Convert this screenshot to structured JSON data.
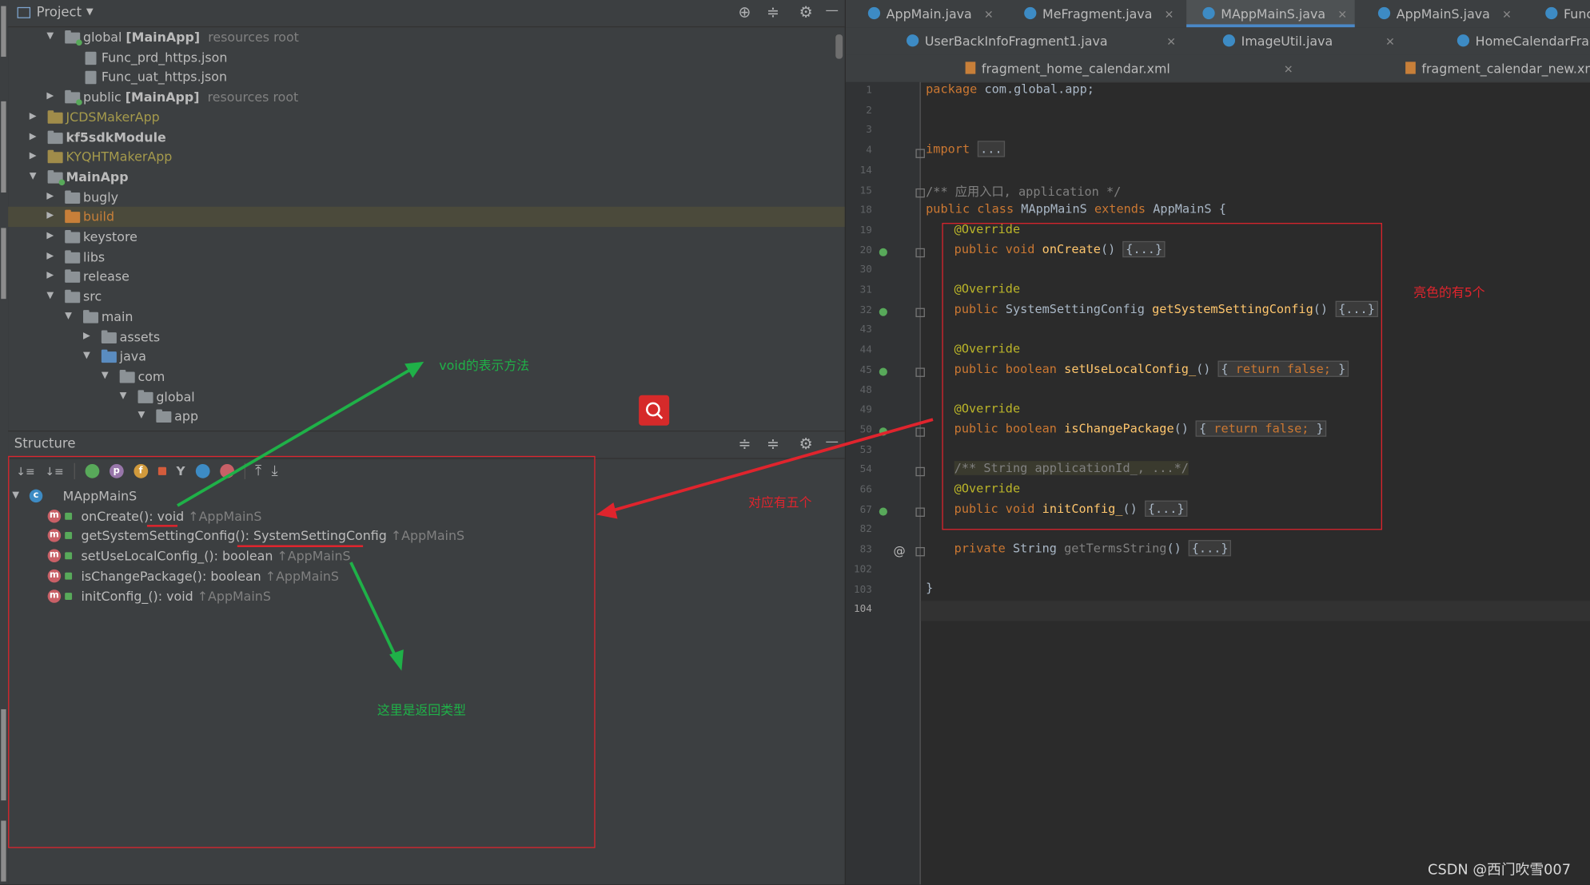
{
  "project_header": {
    "title": "Project",
    "title_caret": "▼",
    "crosshair_icon": "⊕",
    "collapse_icon": "≑",
    "gear_icon": "⚙",
    "minimize_icon": "—"
  },
  "project_tree": [
    {
      "name": "global",
      "suffix": "[MainApp]",
      "hint": "resources root",
      "arrow": "▼"
    },
    {
      "name": "Func_prd_https.json"
    },
    {
      "name": "Func_uat_https.json"
    },
    {
      "name": "public",
      "suffix": "[MainApp]",
      "hint": "resources root",
      "arrow": "▶"
    },
    {
      "name": "JCDSMakerApp",
      "arrow": "▶"
    },
    {
      "name": "kf5sdkModule",
      "arrow": "▶"
    },
    {
      "name": "KYQHTMakerApp",
      "arrow": "▶"
    },
    {
      "name": "MainApp",
      "arrow": "▼"
    },
    {
      "name": "bugly",
      "arrow": "▶"
    },
    {
      "name": "build",
      "arrow": "▶"
    },
    {
      "name": "keystore",
      "arrow": "▶"
    },
    {
      "name": "libs",
      "arrow": "▶"
    },
    {
      "name": "release",
      "arrow": "▶"
    },
    {
      "name": "src",
      "arrow": "▼"
    },
    {
      "name": "main",
      "arrow": "▼"
    },
    {
      "name": "assets",
      "arrow": "▶"
    },
    {
      "name": "java",
      "arrow": "▼"
    },
    {
      "name": "com",
      "arrow": "▼"
    },
    {
      "name": "global",
      "arrow": "▼"
    },
    {
      "name": "app",
      "arrow": "▼"
    }
  ],
  "structure_header": {
    "title": "Structure",
    "expand_icon": "≑",
    "collapse_icon": "≑",
    "gear_icon": "⚙",
    "minimize_icon": "—"
  },
  "structure_toolbar": {
    "sort_alpha_icon": "↓≡",
    "sort_type_icon": "↓≡",
    "p_badge": "p",
    "f_badge": "f",
    "branch_icon": "Y",
    "up_arrow": "⤒",
    "down_arrow": "⤓"
  },
  "structure_tree": {
    "root": {
      "arrow": "▼",
      "badge": "c",
      "name": "MAppMainS"
    },
    "methods": [
      {
        "badge": "m",
        "signature": "onCreate(): void",
        "inherited": "↑AppMainS"
      },
      {
        "badge": "m",
        "signature": "getSystemSettingConfig(): SystemSettingConfig",
        "inherited": "↑AppMainS"
      },
      {
        "badge": "m",
        "signature": "setUseLocalConfig_(): boolean",
        "inherited": "↑AppMainS"
      },
      {
        "badge": "m",
        "signature": "isChangePackage(): boolean",
        "inherited": "↑AppMainS"
      },
      {
        "badge": "m",
        "signature": "initConfig_(): void",
        "inherited": "↑AppMainS"
      }
    ]
  },
  "editor_tabs": {
    "row1": [
      {
        "label": "AppMain.java",
        "close": "✕"
      },
      {
        "label": "MeFragment.java",
        "close": "✕"
      },
      {
        "label": "MAppMainS.java",
        "close": "✕",
        "active": true
      },
      {
        "label": "AppMainS.java",
        "close": "✕"
      },
      {
        "label": "Func"
      }
    ],
    "row2": [
      {
        "label": "UserBackInfoFragment1.java",
        "close": "✕"
      },
      {
        "label": "ImageUtil.java",
        "close": "✕"
      },
      {
        "label": "HomeCalendarFrag"
      }
    ],
    "row3": [
      {
        "label": "fragment_home_calendar.xml",
        "close": "✕"
      },
      {
        "label": "fragment_calendar_new.xml"
      }
    ]
  },
  "line_numbers": [
    "1",
    "2",
    "3",
    "4",
    "14",
    "15",
    "18",
    "19",
    "20",
    "30",
    "31",
    "32",
    "43",
    "44",
    "45",
    "48",
    "49",
    "50",
    "53",
    "54",
    "66",
    "67",
    "82",
    "83",
    "102",
    "103",
    "104"
  ],
  "code": {
    "l1_kw": "package",
    "l1_rest": " com.global.app;",
    "l4_kw": "import",
    "l4_fold": "...",
    "l15": "/** 应用入口, application */",
    "l18_kw": "public class",
    "l18_name": " MAppMainS ",
    "l18_ext": "extends",
    "l18_rest": " AppMainS {",
    "override": "@Override",
    "m1_kw": "public void",
    "m1_fn": "onCreate",
    "m1_rest": "() ",
    "m1_fold": "{...}",
    "m2_kw": "public",
    "m2_type": " SystemSettingConfig ",
    "m2_fn": "getSystemSettingConfig",
    "m2_rest": "() ",
    "m2_fold": "{...}",
    "m3_kw": "public boolean",
    "m3_fn": "setUseLocalConfig_",
    "m3_rest": "() ",
    "m3_fold_open": "{ ",
    "m3_ret": "return false;",
    "m3_fold_close": " }",
    "m4_kw": "public boolean",
    "m4_fn": "isChangePackage",
    "m4_rest": "() ",
    "m4_fold_open": "{ ",
    "m4_ret": "return false;",
    "m4_fold_close": " }",
    "doc54": "/** String applicationId_, ...*/",
    "m5_kw": "public void",
    "m5_fn": "initConfig_",
    "m5_rest": "() ",
    "m5_fold": "{...}",
    "p_kw": "private",
    "p_type": " String ",
    "p_fn": "getTermsString",
    "p_rest": "() ",
    "p_fold": "{...}",
    "closing": "}",
    "at_marker": "@"
  },
  "annotations": {
    "void_note": "void的表示方法",
    "five_note": "对应有五个",
    "bright_note": "亮色的有5个",
    "return_note": "这里是返回类型",
    "watermark": "CSDN @西门吹雪007"
  },
  "colors": {
    "annotation_red": "#e0242d",
    "annotation_green": "#1fb148",
    "accent_blue": "#4a88c7"
  }
}
